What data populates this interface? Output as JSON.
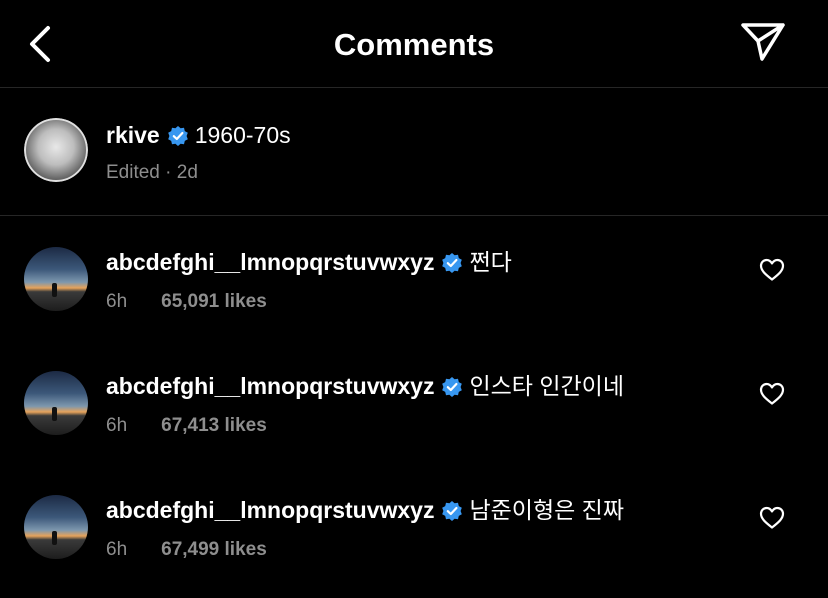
{
  "header": {
    "title": "Comments",
    "back_icon": "chevron-left-icon",
    "share_icon": "paper-plane-icon"
  },
  "caption": {
    "username": "rkive",
    "verified": true,
    "text": "1960-70s",
    "meta": "Edited · 2d"
  },
  "comments": [
    {
      "username": "abcdefghi__lmnopqrstuvwxyz",
      "verified": true,
      "text": "쩐다",
      "time": "6h",
      "likes": "65,091 likes"
    },
    {
      "username": "abcdefghi__lmnopqrstuvwxyz",
      "verified": true,
      "text": "인스타 인간이네",
      "time": "6h",
      "likes": "67,413 likes"
    },
    {
      "username": "abcdefghi__lmnopqrstuvwxyz",
      "verified": true,
      "text": "남준이형은 진짜",
      "time": "6h",
      "likes": "67,499 likes"
    }
  ],
  "colors": {
    "background": "#000000",
    "text": "#ffffff",
    "muted": "#8e8e8e",
    "verified_badge": "#3897f0",
    "divider": "#262626"
  }
}
